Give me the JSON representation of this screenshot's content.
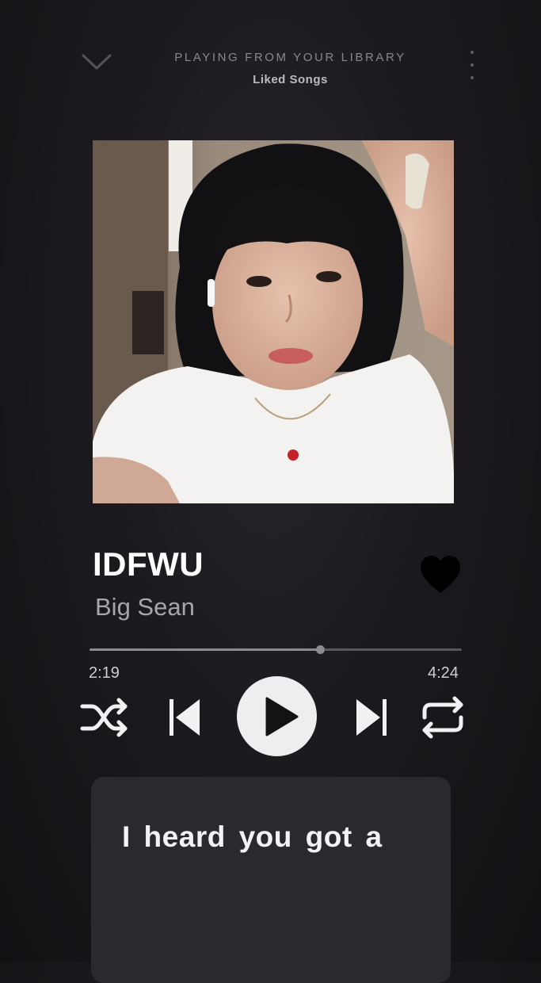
{
  "header": {
    "context_label": "PLAYING FROM YOUR LIBRARY",
    "context_name": "Liked Songs",
    "collapse_icon": "chevron-down-icon",
    "more_icon": "more-vertical-icon"
  },
  "album_art": {
    "description_icon": "album-art-photo"
  },
  "track": {
    "title": "IDFWU",
    "artist": "Big Sean",
    "liked": true
  },
  "progress": {
    "current": "2:19",
    "total": "4:24",
    "fraction": 0.62
  },
  "controls": {
    "shuffle_icon": "shuffle-icon",
    "previous_icon": "skip-previous-icon",
    "play_icon": "play-icon",
    "next_icon": "skip-next-icon",
    "repeat_icon": "repeat-icon"
  },
  "lyrics": {
    "current_line": "I heard you got a"
  },
  "colors": {
    "background": "#1c1a1e",
    "lyrics_card": "#2b292d",
    "play_button": "#efedf0",
    "heart": "#000000"
  }
}
